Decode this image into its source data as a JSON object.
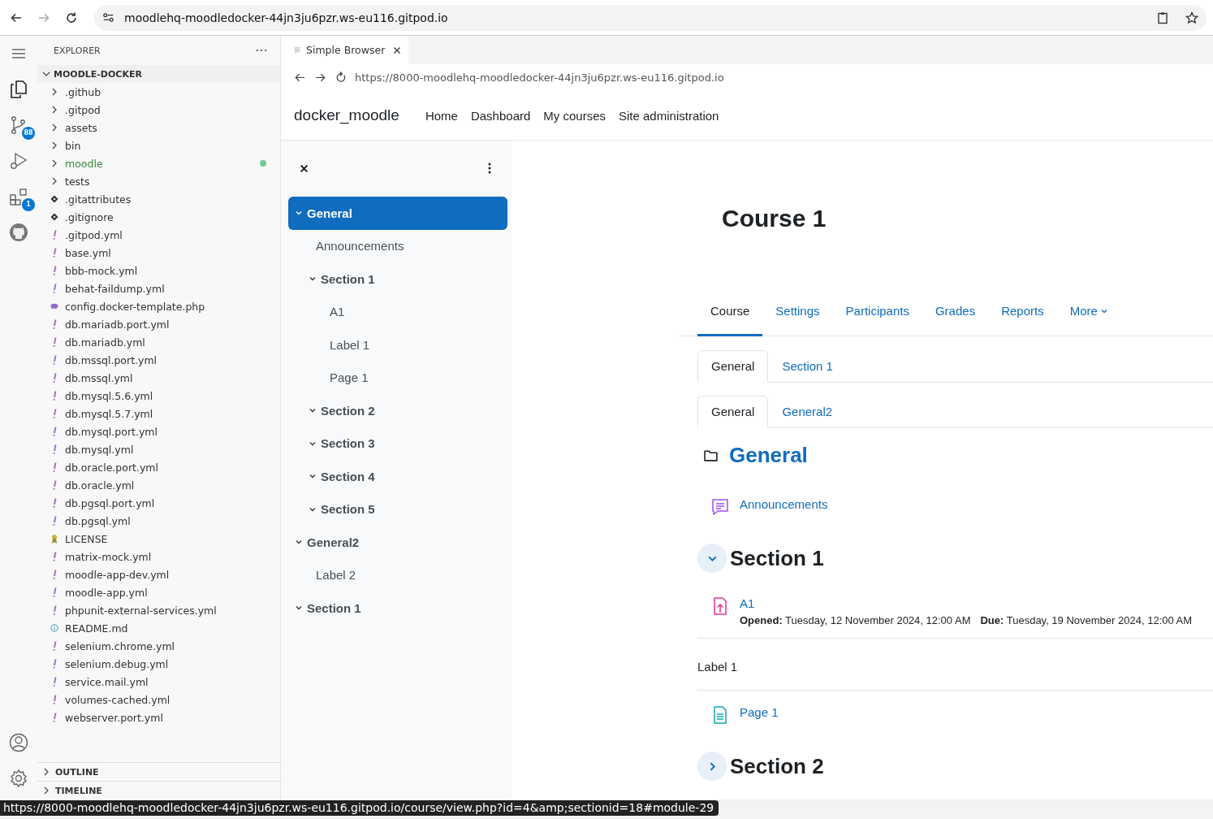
{
  "browser": {
    "url": "moodlehq-moodledocker-44jn3ju6pzr.ws-eu116.gitpod.io"
  },
  "activity_bar": {
    "source_control_badge": "88",
    "extensions_badge": "1"
  },
  "explorer": {
    "title": "EXPLORER",
    "folder": "MOODLE-DOCKER",
    "items": [
      {
        "name": ".github",
        "kind": "folder",
        "modified": false
      },
      {
        "name": ".gitpod",
        "kind": "folder",
        "modified": false
      },
      {
        "name": "assets",
        "kind": "folder",
        "modified": false
      },
      {
        "name": "bin",
        "kind": "folder",
        "modified": false
      },
      {
        "name": "moodle",
        "kind": "folder",
        "modified": true
      },
      {
        "name": "tests",
        "kind": "folder",
        "modified": false
      },
      {
        "name": ".gitattributes",
        "kind": "git",
        "modified": false
      },
      {
        "name": ".gitignore",
        "kind": "git",
        "modified": false
      },
      {
        "name": ".gitpod.yml",
        "kind": "yaml",
        "modified": false
      },
      {
        "name": "base.yml",
        "kind": "yaml",
        "modified": false
      },
      {
        "name": "bbb-mock.yml",
        "kind": "yaml",
        "modified": false
      },
      {
        "name": "behat-faildump.yml",
        "kind": "yaml",
        "modified": false
      },
      {
        "name": "config.docker-template.php",
        "kind": "php",
        "modified": false
      },
      {
        "name": "db.mariadb.port.yml",
        "kind": "yaml",
        "modified": false
      },
      {
        "name": "db.mariadb.yml",
        "kind": "yaml",
        "modified": false
      },
      {
        "name": "db.mssql.port.yml",
        "kind": "yaml",
        "modified": false
      },
      {
        "name": "db.mssql.yml",
        "kind": "yaml",
        "modified": false
      },
      {
        "name": "db.mysql.5.6.yml",
        "kind": "yaml",
        "modified": false
      },
      {
        "name": "db.mysql.5.7.yml",
        "kind": "yaml",
        "modified": false
      },
      {
        "name": "db.mysql.port.yml",
        "kind": "yaml",
        "modified": false
      },
      {
        "name": "db.mysql.yml",
        "kind": "yaml",
        "modified": false
      },
      {
        "name": "db.oracle.port.yml",
        "kind": "yaml",
        "modified": false
      },
      {
        "name": "db.oracle.yml",
        "kind": "yaml",
        "modified": false
      },
      {
        "name": "db.pgsql.port.yml",
        "kind": "yaml",
        "modified": false
      },
      {
        "name": "db.pgsql.yml",
        "kind": "yaml",
        "modified": false
      },
      {
        "name": "LICENSE",
        "kind": "license",
        "modified": false
      },
      {
        "name": "matrix-mock.yml",
        "kind": "yaml",
        "modified": false
      },
      {
        "name": "moodle-app-dev.yml",
        "kind": "yaml",
        "modified": false
      },
      {
        "name": "moodle-app.yml",
        "kind": "yaml",
        "modified": false
      },
      {
        "name": "phpunit-external-services.yml",
        "kind": "yaml",
        "modified": false
      },
      {
        "name": "README.md",
        "kind": "info",
        "modified": false
      },
      {
        "name": "selenium.chrome.yml",
        "kind": "yaml",
        "modified": false
      },
      {
        "name": "selenium.debug.yml",
        "kind": "yaml",
        "modified": false
      },
      {
        "name": "service.mail.yml",
        "kind": "yaml",
        "modified": false
      },
      {
        "name": "volumes-cached.yml",
        "kind": "yaml",
        "modified": false
      },
      {
        "name": "webserver.port.yml",
        "kind": "yaml",
        "modified": false
      }
    ],
    "panels": [
      "OUTLINE",
      "TIMELINE"
    ]
  },
  "editor": {
    "tab": "Simple Browser",
    "url": "https://8000-moodlehq-moodledocker-44jn3ju6pzr.ws-eu116.gitpod.io"
  },
  "site": {
    "name": "docker_moodle",
    "nav": [
      "Home",
      "Dashboard",
      "My courses",
      "Site administration"
    ]
  },
  "course_index": {
    "items": [
      {
        "label": "General",
        "kind": "section",
        "expanded": true,
        "selected": true,
        "children": [
          {
            "label": "Announcements",
            "kind": "activity",
            "selected": false
          },
          {
            "label": "Section 1",
            "kind": "section",
            "expanded": true,
            "selected": false,
            "children": [
              {
                "label": "A1",
                "kind": "activity",
                "selected": false
              },
              {
                "label": "Label 1",
                "kind": "activity",
                "selected": false
              },
              {
                "label": "Page 1",
                "kind": "activity",
                "selected": false
              }
            ]
          },
          {
            "label": "Section 2",
            "kind": "section",
            "expanded": true,
            "selected": false
          },
          {
            "label": "Section 3",
            "kind": "section",
            "expanded": true,
            "selected": false
          },
          {
            "label": "Section 4",
            "kind": "section",
            "expanded": true,
            "selected": false
          },
          {
            "label": "Section 5",
            "kind": "section",
            "expanded": true,
            "selected": false
          }
        ]
      },
      {
        "label": "General2",
        "kind": "section",
        "expanded": true,
        "selected": false,
        "children": [
          {
            "label": "Label 2",
            "kind": "activity",
            "selected": false
          }
        ]
      },
      {
        "label": "Section 1",
        "kind": "section",
        "expanded": true,
        "selected": false
      }
    ]
  },
  "course": {
    "title": "Course 1",
    "tabs": [
      {
        "label": "Course",
        "selected": true,
        "has_menu": false
      },
      {
        "label": "Settings",
        "selected": false,
        "has_menu": false
      },
      {
        "label": "Participants",
        "selected": false,
        "has_menu": false
      },
      {
        "label": "Grades",
        "selected": false,
        "has_menu": false
      },
      {
        "label": "Reports",
        "selected": false,
        "has_menu": false
      },
      {
        "label": "More",
        "selected": false,
        "has_menu": true
      }
    ],
    "section_tabs": [
      {
        "label": "General",
        "selected": true
      },
      {
        "label": "Section 1",
        "selected": false
      }
    ],
    "subsection_tabs": [
      {
        "label": "General",
        "selected": true
      },
      {
        "label": "General2",
        "selected": false
      }
    ],
    "sections": [
      {
        "title": "General",
        "kind": "subsection",
        "expanded": true,
        "activities": [
          {
            "kind": "forum",
            "name": "Announcements"
          }
        ]
      },
      {
        "title": "Section 1",
        "kind": "section",
        "expanded": true,
        "activities": [
          {
            "kind": "assign",
            "name": "A1",
            "dates": [
              {
                "label": "Opened:",
                "value": "Tuesday, 12 November 2024, 12:00 AM"
              },
              {
                "label": "Due:",
                "value": "Tuesday, 19 November 2024, 12:00 AM"
              }
            ]
          },
          {
            "kind": "label",
            "name": "Label 1"
          },
          {
            "kind": "page",
            "name": "Page 1"
          }
        ]
      },
      {
        "title": "Section 2",
        "kind": "section",
        "expanded": false
      }
    ]
  },
  "status_url": "https://8000-moodlehq-moodledocker-44jn3ju6pzr.ws-eu116.gitpod.io/course/view.php?id=4&amp;sectionid=18#module-29"
}
